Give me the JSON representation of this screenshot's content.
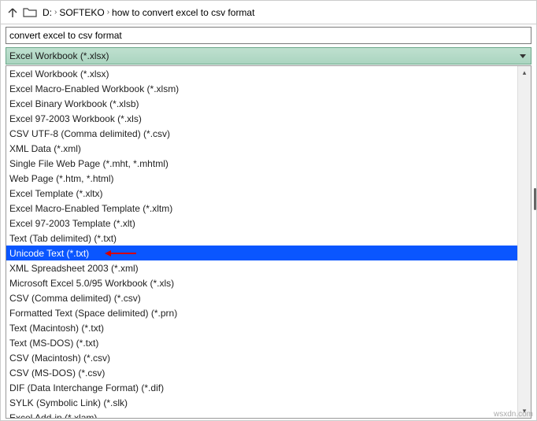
{
  "breadcrumb": {
    "segments": [
      "D:",
      "SOFTEKO",
      "how to convert excel to csv format"
    ]
  },
  "search": {
    "value": "convert excel to csv format"
  },
  "selector": {
    "label": "Excel Workbook (*.xlsx)"
  },
  "dropdown": {
    "items": [
      "Excel Workbook (*.xlsx)",
      "Excel Macro-Enabled Workbook (*.xlsm)",
      "Excel Binary Workbook (*.xlsb)",
      "Excel 97-2003 Workbook (*.xls)",
      "CSV UTF-8 (Comma delimited) (*.csv)",
      "XML Data (*.xml)",
      "Single File Web Page (*.mht, *.mhtml)",
      "Web Page (*.htm, *.html)",
      "Excel Template (*.xltx)",
      "Excel Macro-Enabled Template (*.xltm)",
      "Excel 97-2003 Template (*.xlt)",
      "Text (Tab delimited) (*.txt)",
      "Unicode Text (*.txt)",
      "XML Spreadsheet 2003 (*.xml)",
      "Microsoft Excel 5.0/95 Workbook (*.xls)",
      "CSV (Comma delimited) (*.csv)",
      "Formatted Text (Space delimited) (*.prn)",
      "Text (Macintosh) (*.txt)",
      "Text (MS-DOS) (*.txt)",
      "CSV (Macintosh) (*.csv)",
      "CSV (MS-DOS) (*.csv)",
      "DIF (Data Interchange Format) (*.dif)",
      "SYLK (Symbolic Link) (*.slk)",
      "Excel Add-in (*.xlam)"
    ],
    "selectedIndex": 12
  },
  "watermark": "wsxdn.com"
}
